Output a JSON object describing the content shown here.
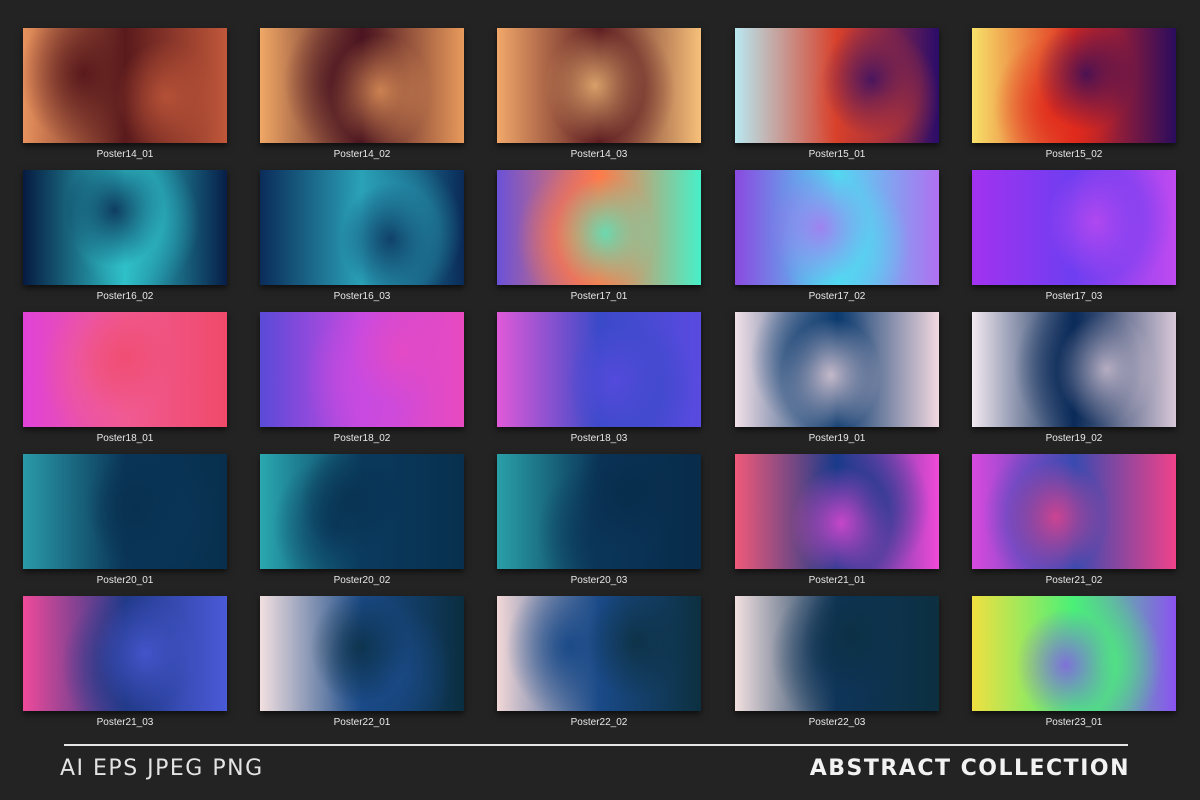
{
  "items": [
    {
      "label": "Poster14_01",
      "colors": [
        "#e8925d",
        "#5a1a1c",
        "#c0573a"
      ]
    },
    {
      "label": "Poster14_02",
      "colors": [
        "#f0a866",
        "#4a1420",
        "#e89a5c"
      ]
    },
    {
      "label": "Poster14_03",
      "colors": [
        "#f2a86a",
        "#5e1e22",
        "#f6c07a"
      ]
    },
    {
      "label": "Poster15_01",
      "colors": [
        "#b9e8f0",
        "#d8402a",
        "#2a0c6a"
      ]
    },
    {
      "label": "Poster15_02",
      "colors": [
        "#f7e26a",
        "#e02a1c",
        "#2a0c5e"
      ]
    },
    {
      "label": "Poster16_02",
      "colors": [
        "#061a40",
        "#2fc0c8",
        "#071e48"
      ]
    },
    {
      "label": "Poster16_03",
      "colors": [
        "#0b2c5a",
        "#2aa2b8",
        "#0a2a58"
      ]
    },
    {
      "label": "Poster17_01",
      "colors": [
        "#6a52d8",
        "#ff7a4a",
        "#47f0c8"
      ]
    },
    {
      "label": "Poster17_02",
      "colors": [
        "#8a4ae0",
        "#52d8f0",
        "#b070f0"
      ]
    },
    {
      "label": "Poster17_03",
      "colors": [
        "#a232f0",
        "#6e3ef0",
        "#c04af0"
      ]
    },
    {
      "label": "Poster18_01",
      "colors": [
        "#e042d8",
        "#f05a92",
        "#f04a6a"
      ]
    },
    {
      "label": "Poster18_02",
      "colors": [
        "#5a4ad8",
        "#c84ae0",
        "#e84ac0"
      ]
    },
    {
      "label": "Poster18_03",
      "colors": [
        "#e05ad8",
        "#3a4ac8",
        "#5a4ae0"
      ]
    },
    {
      "label": "Poster19_01",
      "colors": [
        "#f2e0e8",
        "#0a3a6e",
        "#f2d8e0"
      ]
    },
    {
      "label": "Poster19_02",
      "colors": [
        "#f2e8f0",
        "#0a2a58",
        "#d8c8d8"
      ]
    },
    {
      "label": "Poster20_01",
      "colors": [
        "#2a9aa8",
        "#0a3558",
        "#08304e"
      ]
    },
    {
      "label": "Poster20_02",
      "colors": [
        "#2aa8b0",
        "#0a3a5e",
        "#08304e"
      ]
    },
    {
      "label": "Poster20_03",
      "colors": [
        "#2aa0a8",
        "#0a3458",
        "#082c4a"
      ]
    },
    {
      "label": "Poster21_01",
      "colors": [
        "#f05a7a",
        "#1a3a8a",
        "#f04ad8"
      ]
    },
    {
      "label": "Poster21_02",
      "colors": [
        "#d84ae0",
        "#3a4ab0",
        "#f0428a"
      ]
    },
    {
      "label": "Poster21_03",
      "colors": [
        "#f04a9a",
        "#223a8a",
        "#4a5ad8"
      ]
    },
    {
      "label": "Poster22_01",
      "colors": [
        "#f2e0e0",
        "#1a4a88",
        "#0a2e40"
      ]
    },
    {
      "label": "Poster22_02",
      "colors": [
        "#f2d8d8",
        "#1a4a88",
        "#0c3040"
      ]
    },
    {
      "label": "Poster22_03",
      "colors": [
        "#f2e0e0",
        "#0e3458",
        "#0c3040"
      ]
    },
    {
      "label": "Poster23_01",
      "colors": [
        "#f0e040",
        "#4af078",
        "#8a52f0"
      ]
    }
  ],
  "footer": {
    "formats": "AI EPS JPEG PNG",
    "title": "ABSTRACT COLLECTION"
  }
}
